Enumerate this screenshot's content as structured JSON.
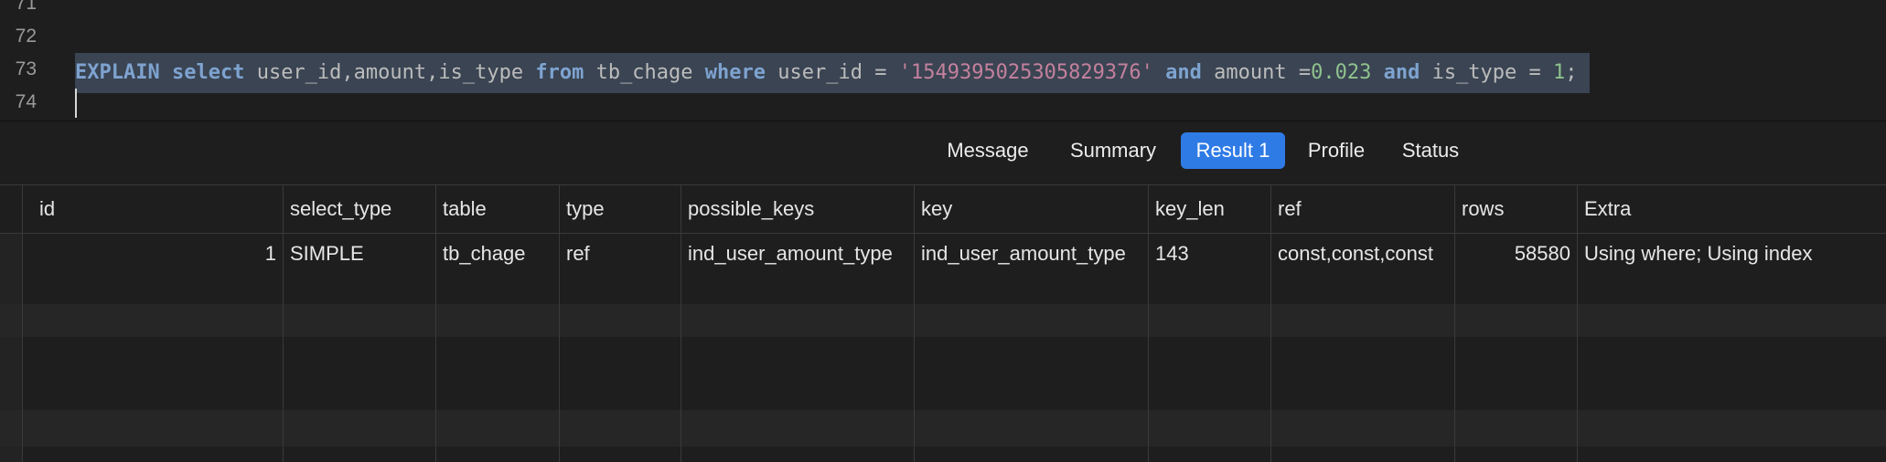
{
  "editor": {
    "lines": [
      {
        "num": "71"
      },
      {
        "num": "72"
      },
      {
        "num": "73"
      },
      {
        "num": "74"
      }
    ],
    "query": {
      "kw_explain": "EXPLAIN",
      "kw_select": "select",
      "columns": " user_id,amount,is_type ",
      "kw_from": "from",
      "table": " tb_chage ",
      "kw_where": "where",
      "cond1": " user_id = ",
      "str_user_id": "'1549395025305829376'",
      "kw_and1": "and",
      "cond2": " amount =",
      "num_amount": "0.023",
      "kw_and2": "and",
      "cond3": " is_type = ",
      "num_type": "1",
      "end": ";"
    }
  },
  "tabs": [
    {
      "label": "Message",
      "active": false
    },
    {
      "label": "Summary",
      "active": false
    },
    {
      "label": "Result 1",
      "active": true
    },
    {
      "label": "Profile",
      "active": false
    },
    {
      "label": "Status",
      "active": false
    }
  ],
  "grid": {
    "columns": [
      "id",
      "select_type",
      "table",
      "type",
      "possible_keys",
      "key",
      "key_len",
      "ref",
      "rows",
      "Extra"
    ],
    "rows": [
      [
        "1",
        "SIMPLE",
        "tb_chage",
        "ref",
        "ind_user_amount_type",
        "ind_user_amount_type",
        "143",
        "const,const,const",
        "58580",
        "Using where; Using index"
      ]
    ]
  },
  "colors": {
    "accent": "#2f7be6",
    "keyword": "#7ea3d0",
    "string": "#c4819d",
    "number": "#8fc28f",
    "selection": "#3a4452"
  }
}
